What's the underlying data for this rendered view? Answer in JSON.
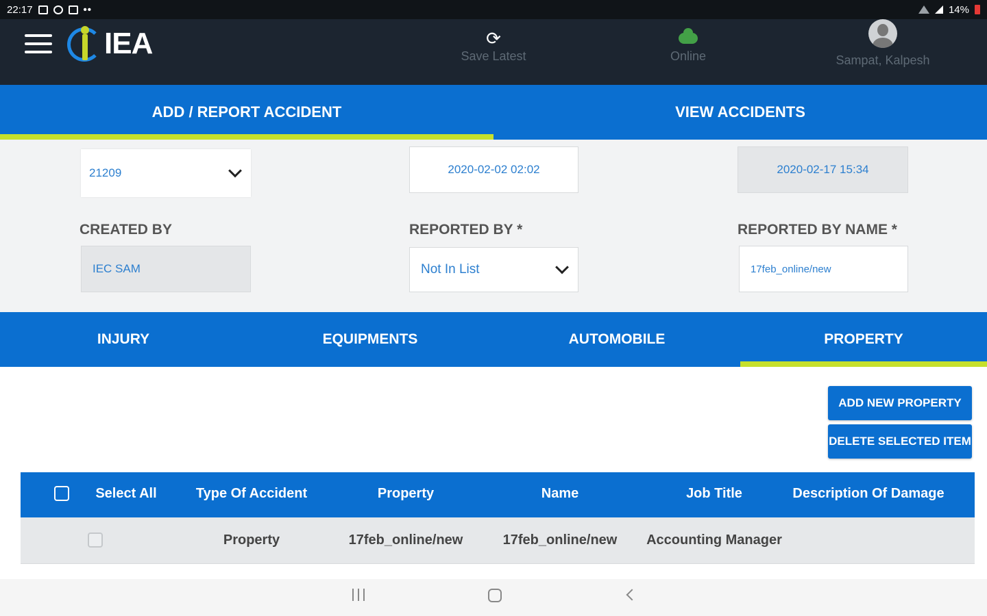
{
  "status_bar": {
    "time": "22:17",
    "dots": "••",
    "battery": "14%"
  },
  "header": {
    "logo_text": "IEA",
    "save_latest": "Save Latest",
    "online": "Online",
    "user_name": "Sampat, Kalpesh"
  },
  "top_tabs": [
    {
      "label": "ADD / REPORT ACCIDENT",
      "active": true
    },
    {
      "label": "VIEW ACCIDENTS",
      "active": false
    }
  ],
  "form": {
    "accident_select": "21209",
    "date_1": "2020-02-02 02:02",
    "date_2": "2020-02-17 15:34",
    "created_by_label": "CREATED BY",
    "created_by_value": "IEC SAM",
    "reported_by_label": "REPORTED BY *",
    "reported_by_value": "Not In List",
    "reported_by_name_label": "REPORTED BY NAME *",
    "reported_by_name_value": "17feb_online/new"
  },
  "sub_tabs": [
    {
      "label": "INJURY",
      "active": false
    },
    {
      "label": "EQUIPMENTS",
      "active": false
    },
    {
      "label": "AUTOMOBILE",
      "active": false
    },
    {
      "label": "PROPERTY",
      "active": true
    }
  ],
  "actions": {
    "add_new_property": "ADD NEW PROPERTY",
    "delete_selected_item": "DELETE SELECTED ITEM"
  },
  "table": {
    "headers": [
      "Select All",
      "Type Of Accident",
      "Property",
      "Name",
      "Job Title",
      "Description Of Damage"
    ],
    "rows": [
      {
        "type": "Property",
        "property": "17feb_online/new",
        "name": "17feb_online/new",
        "job_title": "Accounting Manager",
        "description": ""
      }
    ]
  },
  "icons": {
    "menu": "hamburger-icon",
    "sync": "sync-icon",
    "online": "cloud-icon",
    "user": "user-avatar-icon"
  },
  "colors": {
    "primary": "#0b6fd0",
    "accent": "#c6e02c",
    "header_bg": "#1c2530",
    "field_text": "#2c7fcf"
  }
}
